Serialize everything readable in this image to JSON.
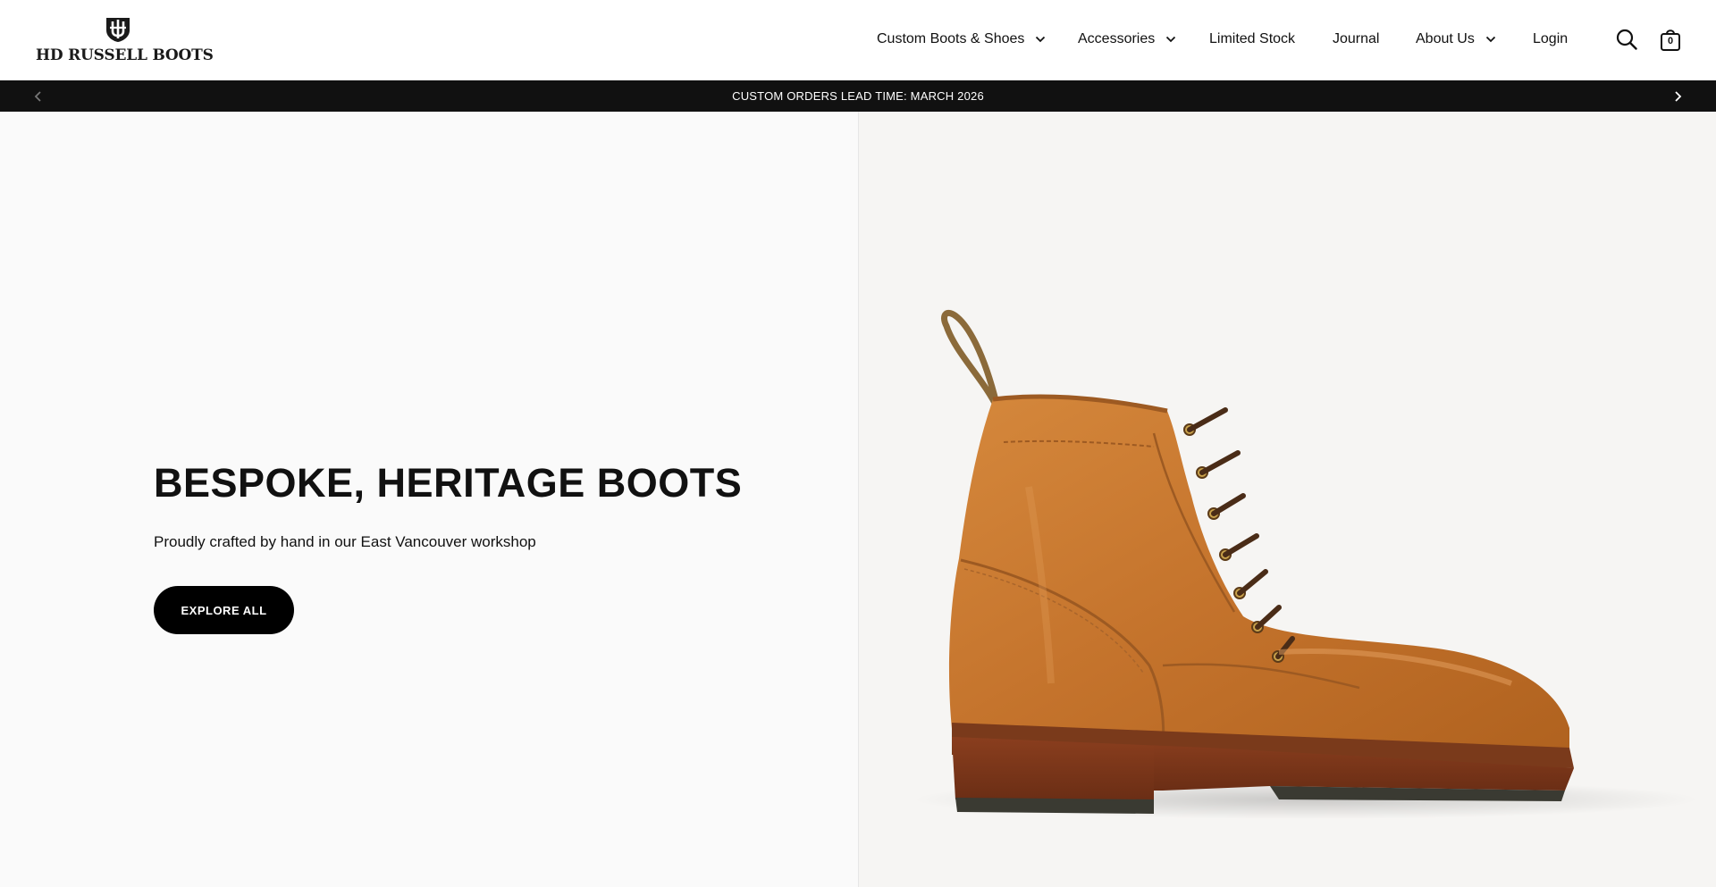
{
  "brand": {
    "name": "HD RUSSELL BOOTS"
  },
  "nav": {
    "items": [
      {
        "label": "Custom Boots & Shoes",
        "has_dropdown": true
      },
      {
        "label": "Accessories",
        "has_dropdown": true
      },
      {
        "label": "Limited Stock",
        "has_dropdown": false
      },
      {
        "label": "Journal",
        "has_dropdown": false
      },
      {
        "label": "About Us",
        "has_dropdown": true
      },
      {
        "label": "Login",
        "has_dropdown": false
      }
    ],
    "search_icon": "search-icon",
    "cart_icon": "shopping-bag-icon",
    "cart_count": "0"
  },
  "announcement": {
    "text": "CUSTOM ORDERS LEAD TIME: MARCH 2026",
    "prev_icon": "chevron-left-icon",
    "next_icon": "chevron-right-icon"
  },
  "hero": {
    "title": "BESPOKE, HERITAGE BOOTS",
    "subtitle": "Proudly crafted by hand in our East Vancouver workshop",
    "cta_label": "EXPLORE ALL",
    "image_subject": "boot-image"
  },
  "colors": {
    "announcement_bg": "#111111",
    "cta_bg": "#000000",
    "boot_leather": "#c8772f"
  }
}
